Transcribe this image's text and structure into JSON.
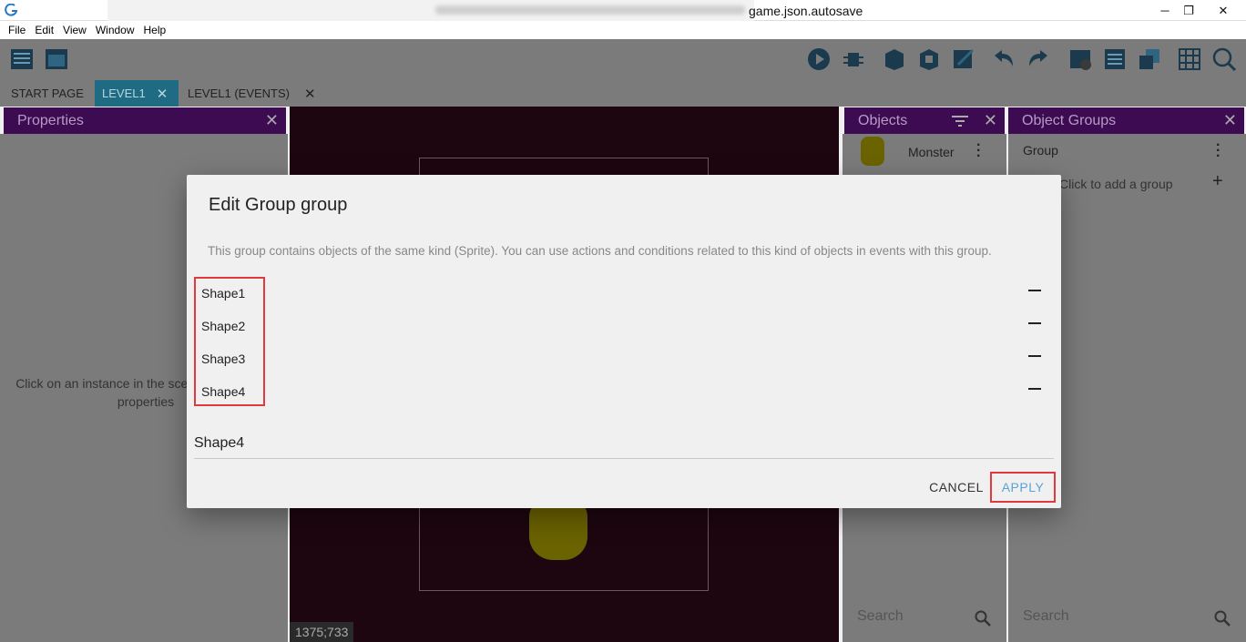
{
  "window": {
    "title": "game.json.autosave",
    "minimize": "─",
    "restore": "❐",
    "close": "✕"
  },
  "menu": [
    "File",
    "Edit",
    "View",
    "Window",
    "Help"
  ],
  "tabs": [
    {
      "label": "START PAGE",
      "closable": false,
      "active": false
    },
    {
      "label": "LEVEL1",
      "closable": true,
      "active": true
    },
    {
      "label": "LEVEL1 (EVENTS)",
      "closable": true,
      "active": false
    }
  ],
  "tab_close": "✕",
  "properties": {
    "title": "Properties",
    "hint": "Click on an instance in the scene to display its properties",
    "close": "✕"
  },
  "scene": {
    "coords": "1375;733"
  },
  "objects": {
    "title": "Objects",
    "items": [
      {
        "name": "Monster"
      }
    ],
    "search_placeholder": "Search",
    "close": "✕"
  },
  "object_groups": {
    "title": "Object Groups",
    "items": [
      {
        "name": "Group"
      }
    ],
    "add_hint": "Click to add a group",
    "search_placeholder": "Search",
    "close": "✕"
  },
  "dialog": {
    "title": "Edit Group group",
    "description": "This group contains objects of the same kind (Sprite). You can use actions and conditions related to this kind of objects in events with this group.",
    "members": [
      "Shape1",
      "Shape2",
      "Shape3",
      "Shape4"
    ],
    "input_value": "Shape4",
    "cancel_label": "CANCEL",
    "apply_label": "APPLY"
  },
  "colors": {
    "panel_header": "#3d0b52",
    "active_tab": "#1f6b83",
    "apply_text": "#5aa3d6",
    "highlight_box": "#e0393e",
    "scene_bg": "#1d0610"
  }
}
